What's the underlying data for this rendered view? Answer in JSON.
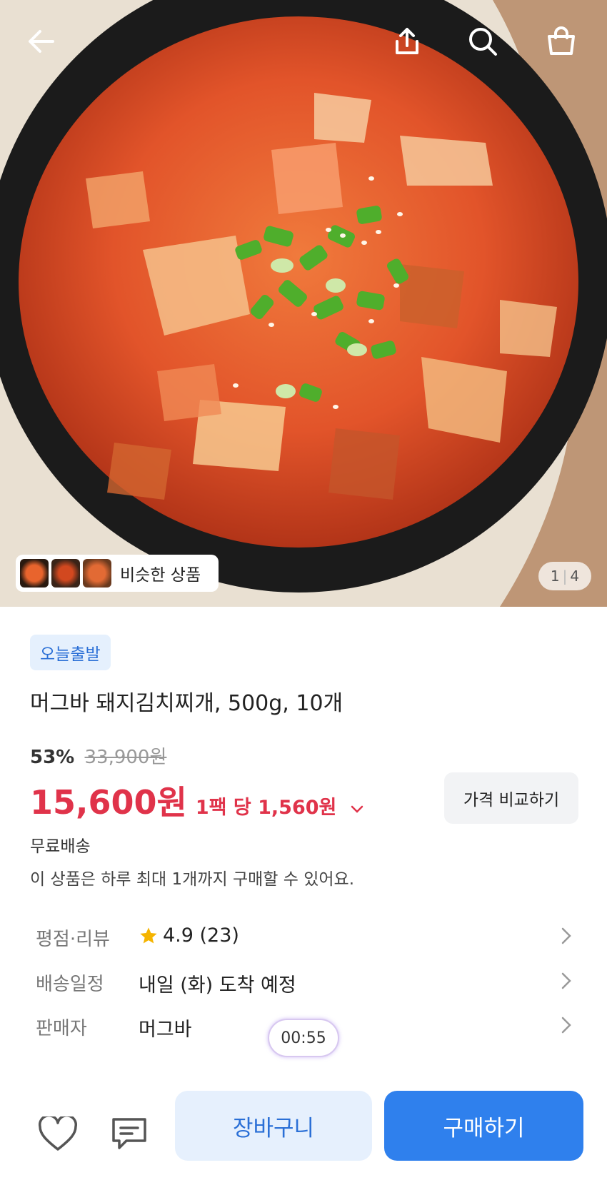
{
  "hero": {
    "similar_label": "비슷한 상품",
    "pager": {
      "current": "1",
      "total": "4"
    }
  },
  "product": {
    "badge": "오늘출발",
    "title": "머그바 돼지김치찌개, 500g, 10개",
    "discount": "53%",
    "original_price": "33,900원",
    "price": "15,600원",
    "unit_price": "1팩 당 1,560원",
    "compare_label": "가격 비교하기",
    "shipping": "무료배송",
    "limit_notice": "이 상품은 하루 최대 1개까지 구매할 수 있어요."
  },
  "details": [
    {
      "key": "평점·리뷰",
      "value": "4.9 (23)",
      "rating": 4.9
    },
    {
      "key": "배송일정",
      "value": "내일 (화) 도착 예정"
    },
    {
      "key": "판매자",
      "value": "머그바"
    }
  ],
  "timer": "00:55",
  "bottom": {
    "cart_label": "장바구니",
    "buy_label": "구매하기"
  },
  "colors": {
    "price_red": "#e0334a",
    "accent_blue": "#2f80ed",
    "badge_bg": "#e5f0fd"
  },
  "icons": [
    "back-arrow-icon",
    "share-icon",
    "search-icon",
    "shopping-bag-icon",
    "heart-icon",
    "chat-icon",
    "chevron-right-icon",
    "chevron-down-icon",
    "star-icon"
  ]
}
